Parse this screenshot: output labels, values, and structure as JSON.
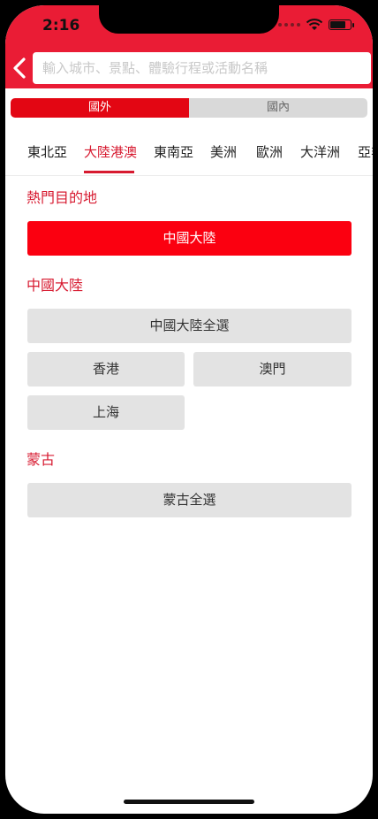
{
  "status": {
    "time": "2:16"
  },
  "search": {
    "placeholder": "輸入城市、景點、體驗行程或活動名稱"
  },
  "segment": {
    "left": "國外",
    "right": "國內"
  },
  "regions": [
    "東北亞",
    "大陸港澳",
    "東南亞",
    "美洲",
    "歐洲",
    "大洋洲",
    "亞非"
  ],
  "hot": {
    "title": "熱門目的地",
    "button": "中國大陸"
  },
  "mainland": {
    "title": "中國大陸",
    "all": "中國大陸全選",
    "items": [
      "香港",
      "澳門",
      "上海"
    ]
  },
  "mongolia": {
    "title": "蒙古",
    "all": "蒙古全選"
  },
  "colors": {
    "header": "#ea1c35",
    "accent": "#d71a30",
    "hot_button": "#fb0010"
  },
  "icons": [
    "back-arrow-icon",
    "wifi-icon",
    "battery-icon",
    "signal-icon"
  ]
}
